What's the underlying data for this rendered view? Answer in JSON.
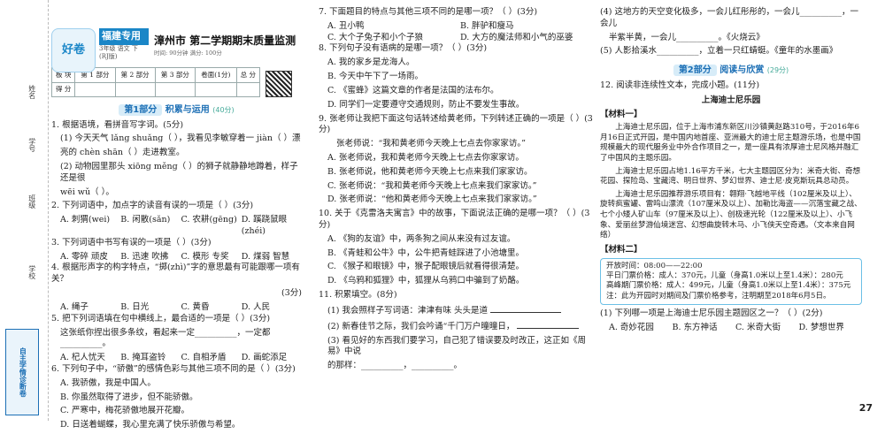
{
  "binding": {
    "name": "姓名",
    "class": "学号",
    "school": "班级",
    "unit": "学校",
    "tag": "自主学情诊断卷"
  },
  "header": {
    "logo": "好卷",
    "brand": "福建专用",
    "brand_sub": "3年级 语文 下 (RJ版)",
    "exam_title": "漳州市 第二学期期末质量监测",
    "exam_meta": "时间: 90分钟  满分: 100分"
  },
  "score_table": {
    "row1": [
      "板 块",
      "第 1 部分",
      "第 2 部分",
      "第 3 部分",
      "卷面(1分)",
      "总 分"
    ],
    "row2": [
      "得 分",
      "",
      "",
      "",
      "",
      ""
    ]
  },
  "part1": {
    "label": "第1部分",
    "name": "积累与运用",
    "points": "(40分)"
  },
  "q1": {
    "stem": "1. 根据语境，看拼音写字词。(5分)",
    "s1": "(1) 今天天气 lǎng shuǎng（        ），我看见李敏穿着一 jiàn（        ）漂",
    "s1b": "亮的 chèn shān（        ）走进教室。",
    "s2": "(2) 动物园里那头 xiōng měng（        ）的狮子就静静地蹲着，样子还是很",
    "s2b": "wēi wǔ（        ）。"
  },
  "q2": {
    "stem": "2. 下列词语中，加点字的读音有误的一项是（    ）(3分)",
    "opts": [
      "A. 刺猬(wei)",
      "B. 闲散(sǎn)",
      "C. 农耕(gēng)",
      "D. 蹊跷鼠眼(zhéi)"
    ]
  },
  "q3": {
    "stem": "3. 下列词语中书写有误的一项是（    ）(3分)",
    "opts": [
      "A. 零碎   顽皮",
      "B. 迅速   吹拂",
      "C. 模形   专奖",
      "D. 煤弱   智慧"
    ]
  },
  "q4": {
    "stem": "4. 根据形声字的构字特点，“掷(zhì)”字的意思最有可能跟哪一项有关？",
    "pts": "(3分)",
    "opts": [
      "A. 绳子",
      "B. 日光",
      "C. 黄昏",
      "D. 人民"
    ]
  },
  "q5": {
    "stem": "5. 把下列词语填在句中横线上，最合适的一项是（    ）(3分)",
    "line": "这张纸你捏出很多条纹，看起来一定__________，一定都__________。",
    "opts": [
      "A. 杞人忧天",
      "B. 掩耳盗铃",
      "C. 自相矛盾",
      "D. 画蛇添足"
    ]
  },
  "q6": {
    "stem": "6. 下列句子中，“骄傲”的感情色彩与其他三项不同的是（    ）(3分)",
    "opts": [
      "A. 我骄傲，我是中国人。",
      "B. 你虽然取得了进步，但不能骄傲。",
      "C. 严寒中，梅花骄傲地展开花瓣。",
      "D. 日送着蝴蝶，我心里充满了快乐骄傲与希望。"
    ]
  },
  "q7": {
    "stem": "7. 下面题目的特点与其他三项不同的是哪一项？（    ）(3分)",
    "opts": [
      "A. 丑小鸭",
      "B. 胖驴和瘦马",
      "C. 大个子兔子和小个子狼",
      "D. 大方的魔法师和小气的巫婆"
    ]
  },
  "q8": {
    "stem": "8. 下列句子没有语病的是哪一项？（    ）(3分)",
    "opts": [
      "A. 我的家乡是龙海人。",
      "B. 今天中午下了一场雨。",
      "C. 《蜜蜂》这篇文章的作者是法国的法布尔。",
      "D. 同学们一定要遵守交通规则，防止不要发生事故。"
    ]
  },
  "q9": {
    "stem": "9. 张老师让我把下面这句话转述给黄老师，下列转述正确的一项是（    ）(3分)",
    "quote": "张老师说：“我和黄老师今天晚上七点去你家家访。”",
    "opts": [
      "A. 张老师说，我和黄老师今天晚上七点去你家家访。",
      "B. 张老师说，他和黄老师今天晚上七点来我们家家访。",
      "C. 张老师说：“我和黄老师今天晚上七点来我们家家访。”",
      "D. 张老师说：“他和黄老师今天晚上七点来我们家家访。”"
    ]
  },
  "q10": {
    "stem": "10. 关于《克雷洛夫寓言》中的故事，下面说法正确的是哪一项？（    ）(3分)",
    "opts": [
      "A. 《狗的友谊》中，两条狗之间从来没有过友谊。",
      "B. 《青蛙和公牛》中，公牛把青蛙踩进了小池塘里。",
      "C. 《猴子和眼镜》中，猴子配眼镜后就看得很清楚。",
      "D. 《乌鸦和狐狸》中，狐狸从乌鸦口中骗到了奶酪。"
    ]
  },
  "q11": {
    "stem": "11. 积累填空。(8分)",
    "s1": "(1) 我会照样子写词语：津津有味    头头是道",
    "s2": "(2) 新春佳节之际，我们会吟诵“千门万户曈曈日，",
    "s3": "(3) 看见好的东西我们要学习，自己犯了错误要及时改正，这正如《周易》中说",
    "s3b": "的那样：__________，__________。"
  },
  "q11c": {
    "s4": "(4) 这地方的天空变化极多，一会儿红彤彤的，一会儿__________，一会儿",
    "s4b": "半紫半黄，一会儿__________。《火烧云》",
    "s5": "(5) 人影拾溪水__________，立着一只红蜻蜓。《童年的水墨画》"
  },
  "part2": {
    "label": "第2部分",
    "name": "阅读与欣赏",
    "points": "(29分)"
  },
  "q12": {
    "stem": "12. 阅读非连续性文本，完成小题。(11分)",
    "title": "上海迪士尼乐园",
    "m1": "【材料一】",
    "p1": "上海迪士尼乐园，位于上海市浦东新区川沙镇黄赵路310号，于2016年6月16日正式开园，是中国内地首座、亚洲最大的迪士尼主题游乐场，也是中国规模最大的现代服务业中外合作项目之一，是一座具有浓厚迪士尼风格并融汇了中国风的主题乐园。",
    "p2": "上海迪士尼乐园占地1.16平方千米，七大主题园区分为：米奇大街、奇想花园、探险岛、宝藏湾、明日世界、梦幻世界、迪士尼·皮克斯玩具总动员。",
    "p3": "上海迪士尼乐园推荐游乐项目有：翱翔·飞越地平线（102厘米及以上）、旋转疯蜜罐、雷鸣山漂流（107厘米及以上）、加勒比海盗——沉落宝藏之战、七个小矮人矿山车（97厘米及以上）、创极速光轮（122厘米及以上）、小飞象、爱丽丝梦游仙境迷宫、幻想曲旋转木马、小飞侠天空奇遇。（文本来自网络）",
    "m2": "【材料二】",
    "info1": "开放时间：08:00——22:00",
    "info2": "平日门票价格：成人：370元，儿童（身高1.0米以上至1.4米）：280元",
    "info3": "高峰期门票价格：成人：499元，儿童（身高1.0米以上至1.4米）：375元",
    "info4": "注：此为开园时对期间及门票价格参考，注明期至2018年6月5日。",
    "sub1": "(1) 下列哪一项是上海迪士尼乐园主题园区之一？（    ）(2分)",
    "opts": [
      "A. 奇妙花园",
      "B. 东方神话",
      "C. 米奇大街",
      "D. 梦想世界"
    ]
  },
  "page_number": "27"
}
